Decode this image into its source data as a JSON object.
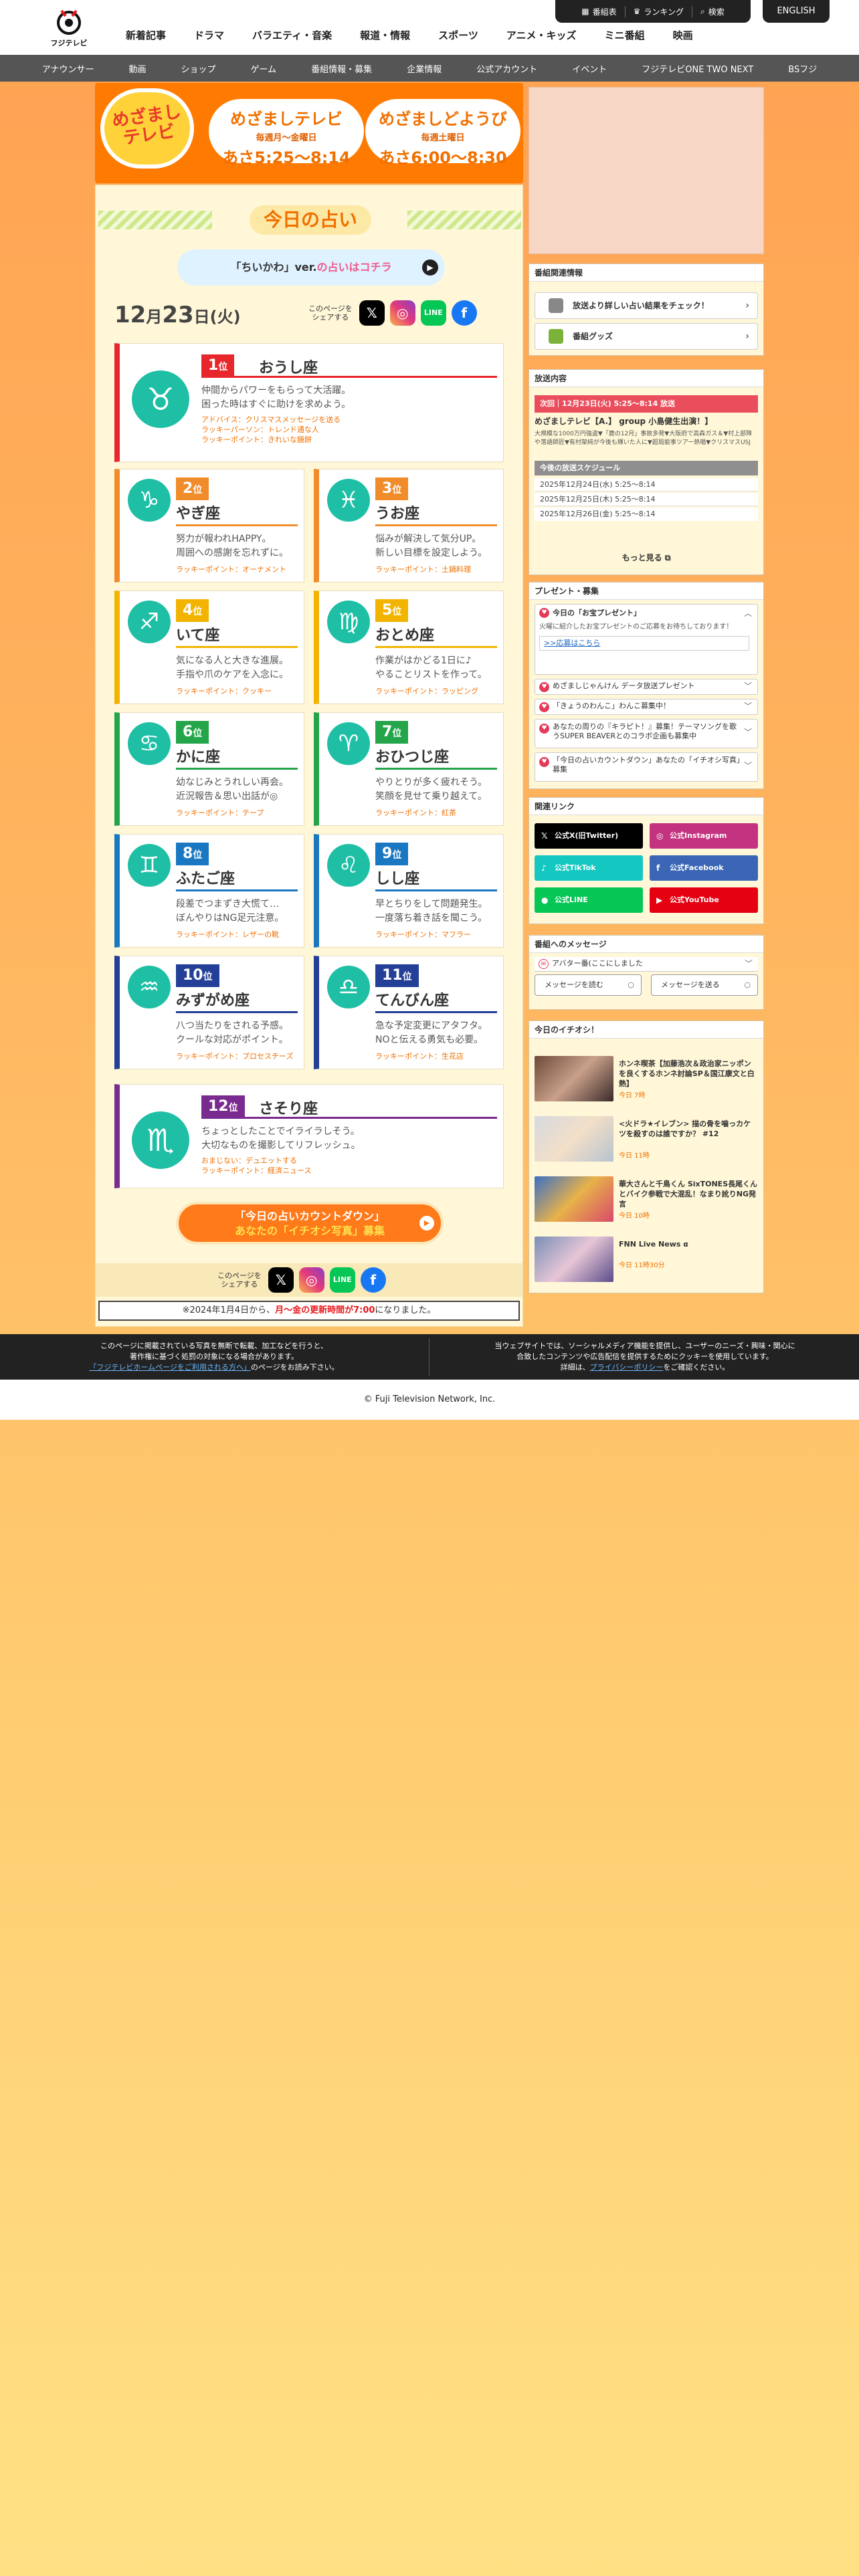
{
  "header": {
    "logo_text": "フジテレビ",
    "nav": [
      "新着記事",
      "ドラマ",
      "バラエティ・音楽",
      "報道・情報",
      "スポーツ",
      "アニメ・キッズ",
      "ミニ番組",
      "映画"
    ],
    "util": [
      "番組表",
      "ランキング",
      "検索"
    ],
    "english": "ENGLISH",
    "subnav": [
      "アナウンサー",
      "動画",
      "ショップ",
      "ゲーム",
      "番組情報・募集",
      "企業情報",
      "公式アカウント",
      "イベント",
      "フジテレビONE TWO NEXT",
      "BSフジ"
    ]
  },
  "banner": {
    "logo": "めざましテレビ",
    "weekday": {
      "title": "めざましテレビ",
      "days": "毎週月〜金曜日",
      "time": "あさ5:25〜8:14"
    },
    "saturday": {
      "title": "めざましどようび",
      "days": "毎週土曜日",
      "time": "あさ6:00〜8:30"
    }
  },
  "fortune": {
    "title": "今日の占い",
    "chiikawa_a": "「ちいかわ」ver.",
    "chiikawa_b": "の占いはコチラ",
    "date_num_a": "12",
    "date_unit_a": "月",
    "date_num_b": "23",
    "date_unit_b": "日(火)",
    "share_label_a": "このページを",
    "share_label_b": "シェアする",
    "share_icons": [
      "x-icon",
      "instagram-icon",
      "line-icon",
      "facebook-icon"
    ],
    "rank_suffix": "位",
    "signs": [
      {
        "rank": "1",
        "name": "おうし座",
        "symbol": "♉",
        "color": "#e8272d",
        "desc": [
          "仲間からパワーをもらって大活躍。",
          "困った時はすぐに助けを求めよう。"
        ],
        "lucky": [
          "アドバイス：クリスマスメッセージを送る",
          "ラッキーパーソン：トレンド通な人",
          "ラッキーポイント：きれいな鏡餅"
        ]
      },
      {
        "rank": "2",
        "name": "やぎ座",
        "symbol": "♑",
        "color": "#f08c2a",
        "desc": [
          "努力が報われHAPPY。",
          "周囲への感謝を忘れずに。"
        ],
        "lucky": [
          "ラッキーポイント：オーナメント"
        ]
      },
      {
        "rank": "3",
        "name": "うお座",
        "symbol": "♓",
        "color": "#f08c2a",
        "desc": [
          "悩みが解決して気分UP。",
          "新しい目標を設定しよう。"
        ],
        "lucky": [
          "ラッキーポイント：土鍋料理"
        ]
      },
      {
        "rank": "4",
        "name": "いて座",
        "symbol": "♐",
        "color": "#f2b400",
        "desc": [
          "気になる人と大きな進展。",
          "手指や爪のケアを入念に。"
        ],
        "lucky": [
          "ラッキーポイント：クッキー"
        ]
      },
      {
        "rank": "5",
        "name": "おとめ座",
        "symbol": "♍",
        "color": "#f2b400",
        "desc": [
          "作業がはかどる1日に♪",
          "やることリストを作って。"
        ],
        "lucky": [
          "ラッキーポイント：ラッピング"
        ]
      },
      {
        "rank": "6",
        "name": "かに座",
        "symbol": "♋",
        "color": "#24a54a",
        "desc": [
          "幼なじみとうれしい再会。",
          "近況報告＆思い出話が◎"
        ],
        "lucky": [
          "ラッキーポイント：テープ"
        ]
      },
      {
        "rank": "7",
        "name": "おひつじ座",
        "symbol": "♈",
        "color": "#24a54a",
        "desc": [
          "やりとりが多く疲れそう。",
          "笑顔を見せて乗り越えて。"
        ],
        "lucky": [
          "ラッキーポイント：紅茶"
        ]
      },
      {
        "rank": "8",
        "name": "ふたご座",
        "symbol": "♊",
        "color": "#1a78c2",
        "desc": [
          "段差でつまずき大慌て…",
          "ぼんやりはNG足元注意。"
        ],
        "lucky": [
          "ラッキーポイント：レザーの靴"
        ]
      },
      {
        "rank": "9",
        "name": "しし座",
        "symbol": "♌",
        "color": "#1a78c2",
        "desc": [
          "早とちりをして問題発生。",
          "一度落ち着き話を聞こう。"
        ],
        "lucky": [
          "ラッキーポイント：マフラー"
        ]
      },
      {
        "rank": "10",
        "name": "みずがめ座",
        "symbol": "♒",
        "color": "#233f97",
        "desc": [
          "八つ当たりをされる予感。",
          "クールな対応がポイント。"
        ],
        "lucky": [
          "ラッキーポイント：プロセスチーズ"
        ]
      },
      {
        "rank": "11",
        "name": "てんびん座",
        "symbol": "♎",
        "color": "#233f97",
        "desc": [
          "急な予定変更にアタフタ。",
          "NOと伝える勇気も必要。"
        ],
        "lucky": [
          "ラッキーポイント：生花店"
        ]
      },
      {
        "rank": "12",
        "name": "さそり座",
        "symbol": "♏",
        "color": "#7a2b8f",
        "desc": [
          "ちょっとしたことでイライラしそう。",
          "大切なものを撮影してリフレッシュ。"
        ],
        "lucky": [
          "おまじない：デュエットする",
          "ラッキーポイント：経済ニュース"
        ]
      }
    ],
    "countdown_a": "「今日の占いカウントダウン」",
    "countdown_b": "あなたの「イチオシ写真」募集",
    "notice_a": "※2024年1月4日から、",
    "notice_b": "月〜金の更新時間が7:00",
    "notice_c": "になりました。"
  },
  "sidebar": {
    "related": {
      "title": "番組関連情報",
      "links": [
        "放送より詳しい占い結果をチェック！",
        "番組グッズ"
      ]
    },
    "broadcast": {
      "title": "放送内容",
      "onair": "次回｜12月23日(火) 5:25〜8:14 放送",
      "headline": "めざましテレビ【A.】 group 小島健生出演！】",
      "desc": "大規模な1000万円強盗▼「鹿の12月」事故多発▼大阪府で高森ガス＆▼村上部隊や落語師匠▼有村架純が今後も輝いた人に▼超局能事ツアー熱唱▼クリスマスUSJ",
      "sched_title": "今後の放送スケジュール",
      "schedule": [
        "2025年12月24日(水) 5:25〜8:14",
        "2025年12月25日(木) 5:25〜8:14",
        "2025年12月26日(金) 5:25〜8:14"
      ],
      "more": "もっと見る"
    },
    "present": {
      "title": "プレゼント・募集",
      "open_title": "今日の「お宝プレゼント」",
      "open_body": "火曜に紹介したお宝プレゼントのご応募をお待ちしております！",
      "apply": ">>応募はこちら",
      "items": [
        "めざましじゃんけん データ放送プレゼント",
        "「きょうのわんこ」わんこ募集中！",
        "あなたの周りの『キラピト！』募集！テーマソングを歌うSUPER BEAVERとのコラボ企画も募集中",
        "「今日の占いカウントダウン」あなたの「イチオシ写真」募集"
      ]
    },
    "sns": {
      "title": "関連リンク",
      "items": [
        {
          "label": "公式X(旧Twitter)",
          "color": "#000000",
          "glyph": "𝕏"
        },
        {
          "label": "公式Instagram",
          "color": "#c4337f",
          "glyph": "◎"
        },
        {
          "label": "公式TikTok",
          "color": "#14c7c0",
          "glyph": "♪"
        },
        {
          "label": "公式Facebook",
          "color": "#3a66b5",
          "glyph": "f"
        },
        {
          "label": "公式LINE",
          "color": "#06c755",
          "glyph": "●"
        },
        {
          "label": "公式YouTube",
          "color": "#e50012",
          "glyph": "▶"
        }
      ]
    },
    "message": {
      "title": "番組へのメッセージ",
      "accordion": "アバター番(ここにしました",
      "read": "メッセージを読む",
      "send": "メッセージを送る"
    },
    "picks": {
      "title": "今日のイチオシ！",
      "items": [
        {
          "title": "ホンネ喫茶【加藤浩次＆政治家ニッポンを良くするホンネ討論SP＆国江康文と白熱】",
          "time": "今日 7時"
        },
        {
          "title": "<火ドラ★イレブン> 描の骨を噛っカケツを殺すのは誰ですか？ #12",
          "time": "今日 11時"
        },
        {
          "title": "華大さんと千鳥くん SixTONES長尾くんとバイク参戦で大混乱！なまり訛りNG発言",
          "time": "今日 10時"
        },
        {
          "title": "FNN Live News α",
          "time": "今日 11時30分"
        }
      ]
    }
  },
  "footer": {
    "left_a": "このページに掲載されている写真を無断で転載、加工などを行うと、",
    "left_b": "著作権に基づく処罰の対象になる場合があります。",
    "left_c": "「フジテレビホームページをご利用される方へ」",
    "left_d": "のページをお読み下さい。",
    "right_a": "当ウェブサイトでは、ソーシャルメディア機能を提供し、ユーザーのニーズ・興味・関心に",
    "right_b": "合致したコンテンツや広告配信を提供するためにクッキーを使用しています。",
    "right_c": "詳細は、",
    "right_d": "プライバシーポリシー",
    "right_e": "をご確認ください。",
    "copyright": "© Fuji Television Network, Inc."
  }
}
